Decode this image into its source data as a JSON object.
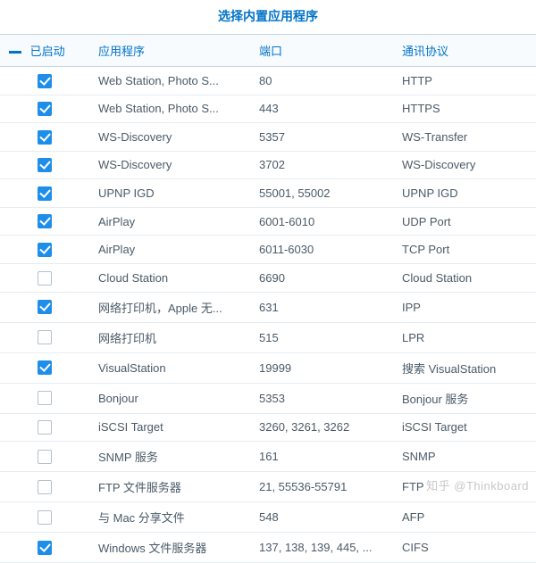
{
  "title": "选择内置应用程序",
  "columns": {
    "enabled": "已启动",
    "app": "应用程序",
    "port": "端口",
    "protocol": "通讯协议"
  },
  "rows": [
    {
      "enabled": true,
      "app": "Web Station, Photo S...",
      "port": "80",
      "protocol": "HTTP"
    },
    {
      "enabled": true,
      "app": "Web Station, Photo S...",
      "port": "443",
      "protocol": "HTTPS"
    },
    {
      "enabled": true,
      "app": "WS-Discovery",
      "port": "5357",
      "protocol": "WS-Transfer"
    },
    {
      "enabled": true,
      "app": "WS-Discovery",
      "port": "3702",
      "protocol": "WS-Discovery"
    },
    {
      "enabled": true,
      "app": "UPNP IGD",
      "port": "55001, 55002",
      "protocol": "UPNP IGD"
    },
    {
      "enabled": true,
      "app": "AirPlay",
      "port": "6001-6010",
      "protocol": "UDP Port"
    },
    {
      "enabled": true,
      "app": "AirPlay",
      "port": "6011-6030",
      "protocol": "TCP Port"
    },
    {
      "enabled": false,
      "app": "Cloud Station",
      "port": "6690",
      "protocol": "Cloud Station"
    },
    {
      "enabled": true,
      "app": "网络打印机，Apple 无...",
      "port": "631",
      "protocol": "IPP"
    },
    {
      "enabled": false,
      "app": "网络打印机",
      "port": "515",
      "protocol": "LPR"
    },
    {
      "enabled": true,
      "app": "VisualStation",
      "port": "19999",
      "protocol": "搜索 VisualStation"
    },
    {
      "enabled": false,
      "app": "Bonjour",
      "port": "5353",
      "protocol": "Bonjour 服务"
    },
    {
      "enabled": false,
      "app": "iSCSI Target",
      "port": "3260, 3261, 3262",
      "protocol": "iSCSI Target"
    },
    {
      "enabled": false,
      "app": "SNMP 服务",
      "port": "161",
      "protocol": "SNMP"
    },
    {
      "enabled": false,
      "app": "FTP 文件服务器",
      "port": "21, 55536-55791",
      "protocol": "FTP"
    },
    {
      "enabled": false,
      "app": "与 Mac 分享文件",
      "port": "548",
      "protocol": "AFP"
    },
    {
      "enabled": true,
      "app": "Windows 文件服务器",
      "port": "137, 138, 139, 445, ...",
      "protocol": "CIFS"
    }
  ],
  "watermark": "知乎 @Thinkboard"
}
